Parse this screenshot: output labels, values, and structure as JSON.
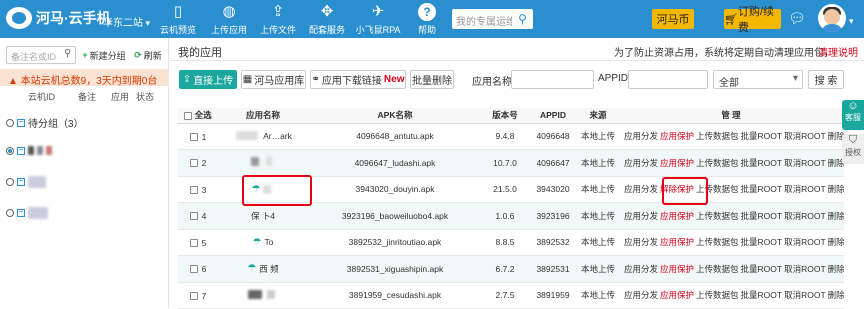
{
  "topbar": {
    "logo_text": "河马·云手机",
    "region": "华东二站",
    "nav": [
      {
        "label": "云机预览",
        "icon": "phone-icon",
        "glyph": "▯"
      },
      {
        "label": "上传应用",
        "icon": "android-icon",
        "glyph": "◍"
      },
      {
        "label": "上传文件",
        "icon": "upload-icon",
        "glyph": "⇪"
      },
      {
        "label": "配套服务",
        "icon": "diamond-grid-icon",
        "glyph": "✥"
      },
      {
        "label": "小飞鼠RPA",
        "icon": "mouse-icon",
        "glyph": "✈"
      },
      {
        "label": "帮助",
        "icon": "help-icon",
        "glyph": "?"
      }
    ],
    "search_placeholder": "我的专属运维",
    "coin_label": "河马币",
    "buy_label": "订购/续费"
  },
  "sidebar": {
    "search_placeholder": "备注名或ID",
    "new_group": "新建分组",
    "refresh": "刷新",
    "warning": "本站云机总数9，3天内到期0台",
    "columns": [
      "云机ID",
      "备注",
      "应用",
      "状态"
    ],
    "group_label": "待分组（3）"
  },
  "main": {
    "title": "我的应用",
    "notice": "为了防止资源占用，系统将定期自动清理应用包，",
    "notice_link": "清理说明",
    "toolbar": {
      "upload": "直接上传",
      "store": "河马应用库",
      "download_link": "应用下载链接",
      "new_badge": "New",
      "batch_delete": "批量删除",
      "app_name_label": "应用名称:",
      "appid_label": "APPID:",
      "select_value": "全部",
      "search": "搜 索"
    },
    "columns": [
      "全选",
      "应用名称",
      "APK名称",
      "版本号",
      "APPID",
      "来源",
      "管 理"
    ],
    "rows": [
      {
        "idx": "1",
        "name": "Ar…ark",
        "apk": "4096648_antutu.apk",
        "ver": "9.4.8",
        "appid": "4096648",
        "src": "本地上传",
        "protect": "应用保护"
      },
      {
        "idx": "2",
        "name": "",
        "apk": "4096647_ludashi.apk",
        "ver": "10.7.0",
        "appid": "4096647",
        "src": "本地上传",
        "protect": "应用保护"
      },
      {
        "idx": "3",
        "name": "",
        "apk": "3943020_douyin.apk",
        "ver": "21.5.0",
        "appid": "3943020",
        "src": "本地上传",
        "protect": "解除保护"
      },
      {
        "idx": "4",
        "name": "保 卜4",
        "apk": "3923196_baoweiluobo4.apk",
        "ver": "1.0.6",
        "appid": "3923196",
        "src": "本地上传",
        "protect": "应用保护"
      },
      {
        "idx": "5",
        "name": "To",
        "apk": "3892532_jinritoutiao.apk",
        "ver": "8.8.5",
        "appid": "3892532",
        "src": "本地上传",
        "protect": "应用保护"
      },
      {
        "idx": "6",
        "name": "西 频",
        "apk": "3892531_xiguashipin.apk",
        "ver": "6.7.2",
        "appid": "3892531",
        "src": "本地上传",
        "protect": "应用保护"
      },
      {
        "idx": "7",
        "name": "",
        "apk": "3891959_cesudashi.apk",
        "ver": "2.7.5",
        "appid": "3891959",
        "src": "本地上传",
        "protect": "应用保护"
      }
    ],
    "ops": {
      "distribute": "应用分发",
      "upload_data": "上传数据包",
      "batch_root": "批量ROOT",
      "cancel_root": "取消ROOT",
      "delete": "删除"
    }
  },
  "float": {
    "service": "客服",
    "auth": "授权"
  },
  "colors": {
    "primary": "#2a8fcf",
    "teal": "#1ba79e",
    "red": "#d9001b",
    "yellow": "#f5b800"
  }
}
